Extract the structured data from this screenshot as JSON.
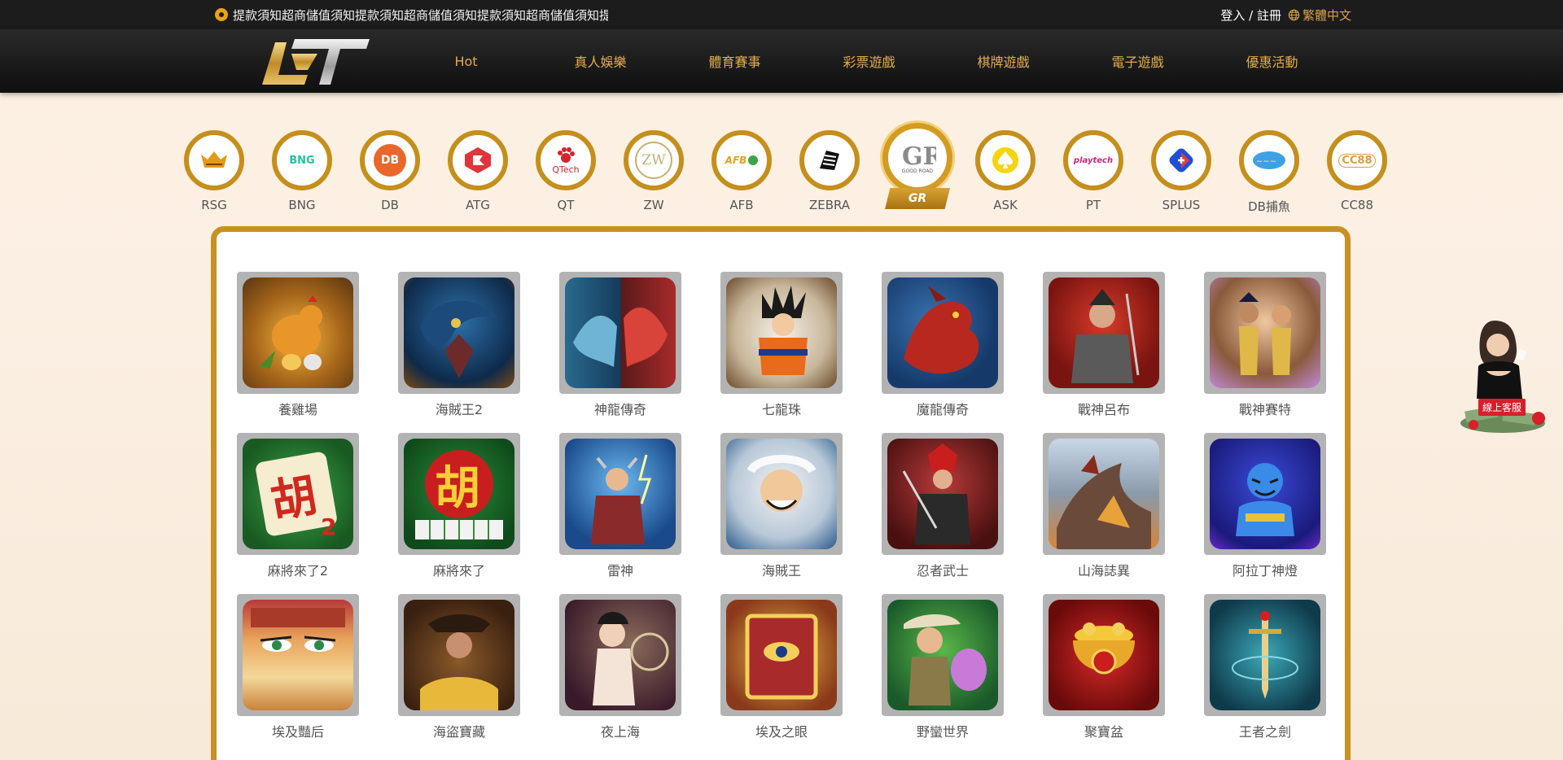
{
  "announcement": "提款須知超商儲值須知提款須知超商儲值須知提款須知超商儲值須知提",
  "auth": {
    "login_register": "登入 / 註冊"
  },
  "language": "繁體中文",
  "nav": [
    "Hot",
    "真人娛樂",
    "體育賽事",
    "彩票遊戲",
    "棋牌遊戲",
    "電子遊戲",
    "優惠活動"
  ],
  "providers": [
    "RSG",
    "BNG",
    "DB",
    "ATG",
    "QT",
    "ZW",
    "AFB",
    "ZEBRA",
    "GR",
    "ASK",
    "PT",
    "SPLUS",
    "DB捕魚",
    "CC88"
  ],
  "active_provider": "GR",
  "provider_logo_text": {
    "bng": "BNG",
    "db": "DB",
    "qt": "QTech",
    "zw": "ZW",
    "afb": "AFB",
    "gr": "GOOD ROAD",
    "pt": "playtech",
    "cc88": "CC88"
  },
  "games": [
    "養雞場",
    "海賊王2",
    "神龍傳奇",
    "七龍珠",
    "魔龍傳奇",
    "戰神呂布",
    "戰神賽特",
    "麻將來了2",
    "麻將來了",
    "雷神",
    "海賊王",
    "忍者武士",
    "山海誌異",
    "阿拉丁神燈",
    "埃及豔后",
    "海盜寶藏",
    "夜上海",
    "埃及之眼",
    "野蠻世界",
    "聚寶盆",
    "王者之劍"
  ],
  "customer_service": "線上客服",
  "colors": {
    "accent": "#c58f1c",
    "nav_text": "#e2ad4c",
    "topbar_bg": "#1c1c1c"
  }
}
